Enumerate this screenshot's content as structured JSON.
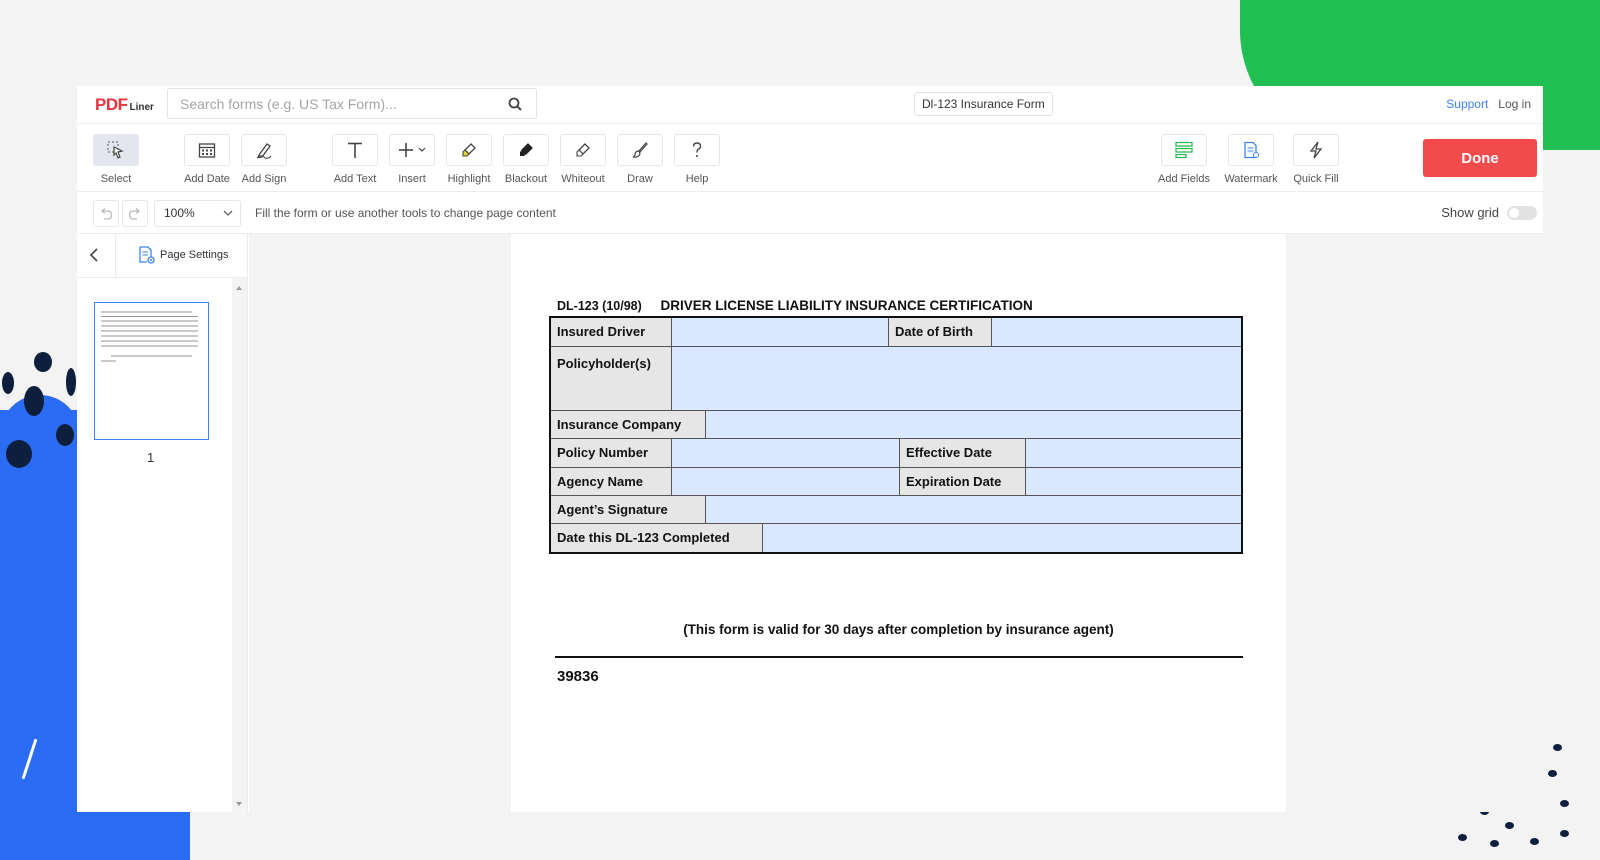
{
  "app": {
    "logo_main": "PDF",
    "logo_sub": "Liner",
    "search_placeholder": "Search forms (e.g. US Tax Form)...",
    "doc_title": "Dl-123 Insurance Form",
    "support": "Support",
    "login": "Log in"
  },
  "toolbar": {
    "tools": [
      "Select",
      "Add Date",
      "Add Sign",
      "Add Text",
      "Insert",
      "Highlight",
      "Blackout",
      "Whiteout",
      "Draw",
      "Help",
      "Add Fields",
      "Watermark",
      "Quick Fill"
    ],
    "done": "Done"
  },
  "subbar": {
    "zoom": "100%",
    "hint": "Fill the form or use another tools to change page content",
    "show_grid": "Show grid"
  },
  "sidebar": {
    "page_settings": "Page Settings",
    "page_number": "1"
  },
  "form": {
    "code": "DL-123 (10/98)",
    "title": "DRIVER LICENSE LIABILITY INSURANCE CERTIFICATION",
    "insured_driver": "Insured Driver",
    "date_of_birth": "Date of Birth",
    "policyholders": "Policyholder(s)",
    "insurance_company": "Insurance Company",
    "policy_number": "Policy Number",
    "effective_date": "Effective Date",
    "agency_name": "Agency Name",
    "expiration_date": "Expiration Date",
    "agents_signature": "Agent’s Signature",
    "date_completed": "Date this DL-123 Completed",
    "validity_note": "(This form is valid for 30 days after completion by insurance agent)",
    "form_number": "39836"
  },
  "colors": {
    "done_button": "#f24b4b",
    "link": "#3b82f6",
    "field_fill": "#d9e8ff",
    "label_fill": "#e6e6e6",
    "deco_blue": "#2b6cf5",
    "deco_green": "#1fbf52"
  }
}
